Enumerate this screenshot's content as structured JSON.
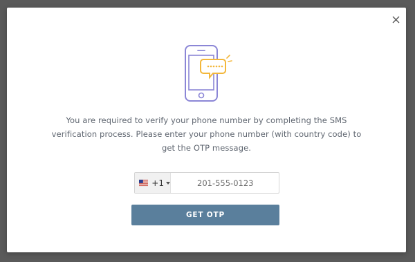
{
  "modal": {
    "close_icon": "close-icon",
    "illustration_icon": "phone-sms-icon",
    "description": "You are required to verify your phone number by completing the SMS verification process. Please enter your phone number (with country code) to get the OTP message.",
    "country": {
      "flag_icon": "us-flag-icon",
      "dial_code": "+1"
    },
    "phone_input": {
      "value": "",
      "placeholder": "201-555-0123"
    },
    "otp_button_label": "GET OTP"
  },
  "colors": {
    "button": "#5a7f9c",
    "phone_outline": "#8b86d6",
    "sms_bubble": "#f3b73b",
    "text": "#5f6670",
    "backdrop": "#5a5a5a"
  }
}
